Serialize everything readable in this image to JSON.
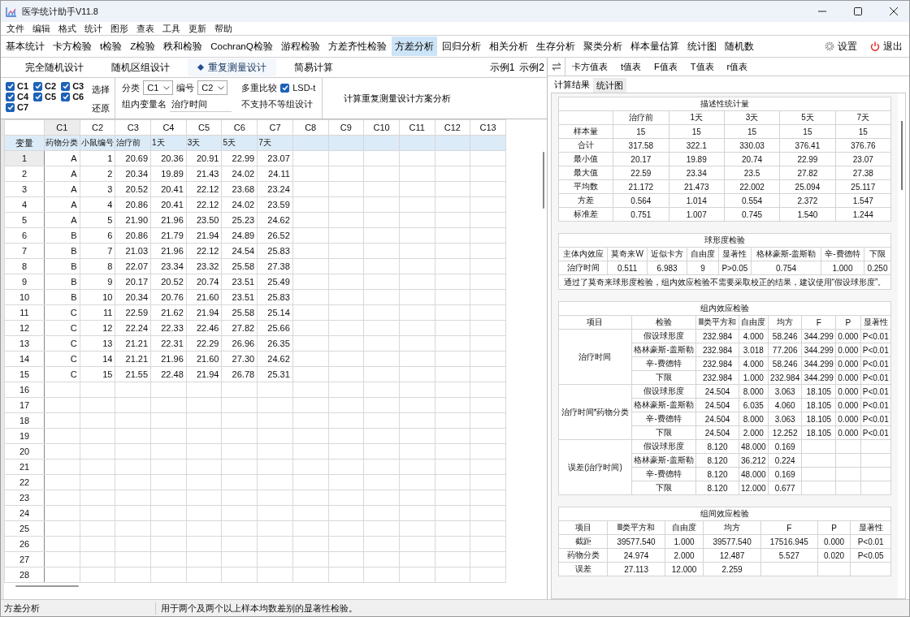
{
  "window": {
    "title": "医学统计助手V11.8"
  },
  "menu": [
    "文件",
    "编辑",
    "格式",
    "统计",
    "图形",
    "查表",
    "工具",
    "更新",
    "帮助"
  ],
  "modules": [
    {
      "label": "基本统计",
      "selected": false
    },
    {
      "label": "卡方检验",
      "selected": false
    },
    {
      "label": "t检验",
      "selected": false
    },
    {
      "label": "Z检验",
      "selected": false
    },
    {
      "label": "秩和检验",
      "selected": false
    },
    {
      "label": "CochranQ检验",
      "selected": false
    },
    {
      "label": "游程检验",
      "selected": false
    },
    {
      "label": "方差齐性检验",
      "selected": false
    },
    {
      "label": "方差分析",
      "selected": true
    },
    {
      "label": "回归分析",
      "selected": false
    },
    {
      "label": "相关分析",
      "selected": false
    },
    {
      "label": "生存分析",
      "selected": false
    },
    {
      "label": "聚类分析",
      "selected": false
    },
    {
      "label": "样本量估算",
      "selected": false
    },
    {
      "label": "统计图",
      "selected": false
    },
    {
      "label": "随机数",
      "selected": false
    }
  ],
  "toolbar_right": [
    {
      "kind": "settings",
      "label": "设置"
    },
    {
      "kind": "exit",
      "label": "退出"
    }
  ],
  "design_tabs": [
    {
      "label": "完全随机设计",
      "selected": false
    },
    {
      "label": "随机区组设计",
      "selected": false
    },
    {
      "label": "重复测量设计",
      "selected": true
    },
    {
      "label": "简易计算",
      "selected": false
    }
  ],
  "examples": [
    "示例1",
    "示例2"
  ],
  "options": {
    "columns": [
      {
        "label": "C1",
        "checked": true
      },
      {
        "label": "C2",
        "checked": true
      },
      {
        "label": "C3",
        "checked": true
      },
      {
        "label": "C4",
        "checked": true
      },
      {
        "label": "C5",
        "checked": true
      },
      {
        "label": "C6",
        "checked": true
      },
      {
        "label": "C7",
        "checked": true
      }
    ],
    "actions": [
      "选择",
      "还原"
    ],
    "category": {
      "label": "分类",
      "value": "C1"
    },
    "id_field": {
      "label": "编号",
      "value": "C2"
    },
    "multiple": {
      "label": "多重比较",
      "option": "LSD-t",
      "checked": true
    },
    "within_name": {
      "label": "组内变量名",
      "value": "治疗时间"
    },
    "note": "不支持不等组设计",
    "run": "计算重复测量设计方案分析"
  },
  "grid": {
    "columns": [
      {
        "label": "C1",
        "selected": true
      },
      {
        "label": "C2",
        "selected": false
      },
      {
        "label": "C3",
        "selected": false
      },
      {
        "label": "C4",
        "selected": false
      },
      {
        "label": "C5",
        "selected": false
      },
      {
        "label": "C6",
        "selected": false
      },
      {
        "label": "C7",
        "selected": false
      },
      {
        "label": "C8",
        "selected": false
      },
      {
        "label": "C9",
        "selected": false
      },
      {
        "label": "C10",
        "selected": false
      },
      {
        "label": "C11",
        "selected": false
      },
      {
        "label": "C12",
        "selected": false
      },
      {
        "label": "C13",
        "selected": false
      }
    ],
    "header_label": "变量",
    "variables": [
      "药物分类",
      "小鼠编号",
      "治疗前",
      "1天",
      "3天",
      "5天",
      "7天"
    ],
    "rows": [
      {
        "label": "1",
        "selected": true,
        "cells": [
          "A",
          "1",
          "20.69",
          "20.36",
          "20.91",
          "22.99",
          "23.07"
        ]
      },
      {
        "label": "2",
        "selected": false,
        "cells": [
          "A",
          "2",
          "20.34",
          "19.89",
          "21.43",
          "24.02",
          "24.11"
        ]
      },
      {
        "label": "3",
        "selected": false,
        "cells": [
          "A",
          "3",
          "20.52",
          "20.41",
          "22.12",
          "23.68",
          "23.24"
        ]
      },
      {
        "label": "4",
        "selected": false,
        "cells": [
          "A",
          "4",
          "20.86",
          "20.41",
          "22.12",
          "24.02",
          "23.59"
        ]
      },
      {
        "label": "5",
        "selected": false,
        "cells": [
          "A",
          "5",
          "21.90",
          "21.96",
          "23.50",
          "25.23",
          "24.62"
        ]
      },
      {
        "label": "6",
        "selected": false,
        "cells": [
          "B",
          "6",
          "20.86",
          "21.79",
          "21.94",
          "24.89",
          "26.52"
        ]
      },
      {
        "label": "7",
        "selected": false,
        "cells": [
          "B",
          "7",
          "21.03",
          "21.96",
          "22.12",
          "24.54",
          "25.83"
        ]
      },
      {
        "label": "8",
        "selected": false,
        "cells": [
          "B",
          "8",
          "22.07",
          "23.34",
          "23.32",
          "25.58",
          "27.38"
        ]
      },
      {
        "label": "9",
        "selected": false,
        "cells": [
          "B",
          "9",
          "20.17",
          "20.52",
          "20.74",
          "23.51",
          "25.49"
        ]
      },
      {
        "label": "10",
        "selected": false,
        "cells": [
          "B",
          "10",
          "20.34",
          "20.76",
          "21.60",
          "23.51",
          "25.83"
        ]
      },
      {
        "label": "11",
        "selected": false,
        "cells": [
          "C",
          "11",
          "22.59",
          "21.62",
          "21.94",
          "25.58",
          "25.14"
        ]
      },
      {
        "label": "12",
        "selected": false,
        "cells": [
          "C",
          "12",
          "22.24",
          "22.33",
          "22.46",
          "27.82",
          "25.66"
        ]
      },
      {
        "label": "13",
        "selected": false,
        "cells": [
          "C",
          "13",
          "21.21",
          "22.31",
          "22.29",
          "26.96",
          "26.35"
        ]
      },
      {
        "label": "14",
        "selected": false,
        "cells": [
          "C",
          "14",
          "21.21",
          "21.96",
          "21.60",
          "27.30",
          "24.62"
        ]
      },
      {
        "label": "15",
        "selected": false,
        "cells": [
          "C",
          "15",
          "21.55",
          "22.48",
          "21.94",
          "26.78",
          "25.31"
        ]
      },
      {
        "label": "16",
        "selected": false
      },
      {
        "label": "17",
        "selected": false
      },
      {
        "label": "18",
        "selected": false
      },
      {
        "label": "19",
        "selected": false
      },
      {
        "label": "20",
        "selected": false
      },
      {
        "label": "21",
        "selected": false
      },
      {
        "label": "22",
        "selected": false
      },
      {
        "label": "23",
        "selected": false
      },
      {
        "label": "24",
        "selected": false
      },
      {
        "label": "25",
        "selected": false
      },
      {
        "label": "26",
        "selected": false
      },
      {
        "label": "27",
        "selected": false
      },
      {
        "label": "28",
        "selected": false
      }
    ]
  },
  "lookup_tables": [
    "卡方值表",
    "t值表",
    "F值表",
    "T值表",
    "r值表"
  ],
  "result_tabs": [
    {
      "label": "计算结果",
      "selected": true
    },
    {
      "label": "统计图",
      "selected": false
    }
  ],
  "results": [
    {
      "kind": "simple",
      "title": "描述性统计量",
      "columns": [
        "",
        "治疗前",
        "1天",
        "3天",
        "5天",
        "7天"
      ],
      "rows": [
        [
          "样本量",
          "15",
          "15",
          "15",
          "15",
          "15"
        ],
        [
          "合计",
          "317.58",
          "322.1",
          "330.03",
          "376.41",
          "376.76"
        ],
        [
          "最小值",
          "20.17",
          "19.89",
          "20.74",
          "22.99",
          "23.07"
        ],
        [
          "最大值",
          "22.59",
          "23.34",
          "23.5",
          "27.82",
          "27.38"
        ],
        [
          "平均数",
          "21.172",
          "21.473",
          "22.002",
          "25.094",
          "25.117"
        ],
        [
          "方差",
          "0.564",
          "1.014",
          "0.554",
          "2.372",
          "1.547"
        ],
        [
          "标准差",
          "0.751",
          "1.007",
          "0.745",
          "1.540",
          "1.244"
        ]
      ]
    },
    {
      "kind": "simple",
      "title": "球形度检验",
      "columns": [
        "主体内效应",
        "莫奇来W",
        "近似卡方",
        "自由度",
        "显著性",
        "格林豪斯-盖斯勒",
        "辛-费德特",
        "下限"
      ],
      "rows": [
        [
          "治疗时间",
          "0.511",
          "6.983",
          "9",
          "P>0.05",
          "0.754",
          "1.000",
          "0.250"
        ]
      ],
      "note": "通过了莫奇来球形度检验，组内效应检验不需要采取校正的结果，建议使用“假设球形度”。"
    },
    {
      "kind": "grouped",
      "title": "组内效应检验",
      "columns": [
        "项目",
        "检验",
        "Ⅲ类平方和",
        "自由度",
        "均方",
        "F",
        "P",
        "显著性"
      ],
      "groups": [
        {
          "label": "治疗时间",
          "rows": [
            [
              "假设球形度",
              "232.984",
              "4.000",
              "58.246",
              "344.299",
              "0.000",
              "P<0.01"
            ],
            [
              "格林豪斯-盖斯勒",
              "232.984",
              "3.018",
              "77.206",
              "344.299",
              "0.000",
              "P<0.01"
            ],
            [
              "辛-费德特",
              "232.984",
              "4.000",
              "58.246",
              "344.299",
              "0.000",
              "P<0.01"
            ],
            [
              "下限",
              "232.984",
              "1.000",
              "232.984",
              "344.299",
              "0.000",
              "P<0.01"
            ]
          ]
        },
        {
          "label": "治疗时间*药物分类",
          "rows": [
            [
              "假设球形度",
              "24.504",
              "8.000",
              "3.063",
              "18.105",
              "0.000",
              "P<0.01"
            ],
            [
              "格林豪斯-盖斯勒",
              "24.504",
              "6.035",
              "4.060",
              "18.105",
              "0.000",
              "P<0.01"
            ],
            [
              "辛-费德特",
              "24.504",
              "8.000",
              "3.063",
              "18.105",
              "0.000",
              "P<0.01"
            ],
            [
              "下限",
              "24.504",
              "2.000",
              "12.252",
              "18.105",
              "0.000",
              "P<0.01"
            ]
          ]
        },
        {
          "label": "误差(治疗时间)",
          "rows": [
            [
              "假设球形度",
              "8.120",
              "48.000",
              "0.169"
            ],
            [
              "格林豪斯-盖斯勒",
              "8.120",
              "36.212",
              "0.224"
            ],
            [
              "辛-费德特",
              "8.120",
              "48.000",
              "0.169"
            ],
            [
              "下限",
              "8.120",
              "12.000",
              "0.677"
            ]
          ]
        }
      ]
    },
    {
      "kind": "simple",
      "title": "组间效应检验",
      "columns": [
        "项目",
        "Ⅲ类平方和",
        "自由度",
        "均方",
        "F",
        "P",
        "显著性"
      ],
      "rows": [
        [
          "截距",
          "39577.540",
          "1.000",
          "39577.540",
          "17516.945",
          "0.000",
          "P<0.01"
        ],
        [
          "药物分类",
          "24.974",
          "2.000",
          "12.487",
          "5.527",
          "0.020",
          "P<0.05"
        ],
        [
          "误差",
          "27.113",
          "12.000",
          "2.259"
        ]
      ]
    }
  ],
  "status_bar": {
    "module": "方差分析",
    "hint": "用于两个及两个以上样本均数差别的显著性检验。"
  }
}
